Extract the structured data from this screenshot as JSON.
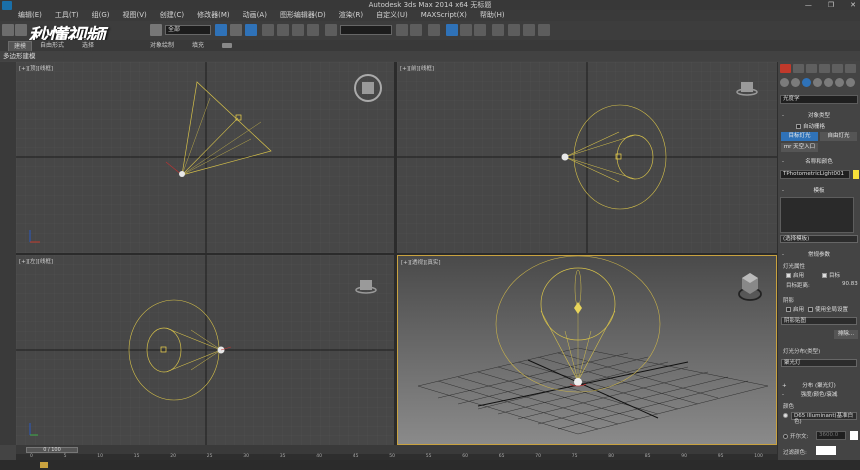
{
  "window": {
    "title": "Autodesk 3ds Max  2014 x64     无标题",
    "controls": [
      "—",
      "❐",
      "✕"
    ]
  },
  "menu": [
    "编辑(E)",
    "工具(T)",
    "组(G)",
    "视图(V)",
    "创建(C)",
    "修改器(M)",
    "动画(A)",
    "图形编辑器(D)",
    "渲染(R)",
    "自定义(U)",
    "MAXScript(X)",
    "帮助(H)"
  ],
  "toolbar": {
    "selection_filter": "全部",
    "view_dropdown": "视图",
    "named_set": ""
  },
  "watermark": "秒懂视频",
  "ribbon": {
    "tabs": [
      "建模",
      "自由形式",
      "选择",
      "对象绘制",
      "填充"
    ],
    "active_tab": "建模"
  },
  "subbar_label": "多边形建模",
  "viewports": [
    {
      "label": "[+][顶][线框]",
      "name": "top"
    },
    {
      "label": "[+][前][线框]",
      "name": "front"
    },
    {
      "label": "[+][左][线框]",
      "name": "left"
    },
    {
      "label": "[+][透视][真实]",
      "name": "perspective"
    }
  ],
  "command_panel": {
    "category_dropdown": "光度学",
    "object_type_title": "对象类型",
    "auto_grid": "自动栅格",
    "btn_target_light": "目标灯光",
    "btn_free_light": "自由灯光",
    "btn_sky_portal": "mr 天空入口",
    "name_color_title": "名称和颜色",
    "object_name": "TPhotometricLight001",
    "template_title": "模板",
    "template_select": "(选择模板)",
    "general_params_title": "常规参数",
    "light_props_title": "灯光属性",
    "enabled_label": "启用",
    "targeted_label": "目标",
    "target_distance_label": "目标距离:",
    "target_distance_value": "90.83",
    "shadows_title": "阴影",
    "shadows_enabled": "启用",
    "use_global": "使用全局设置",
    "shadow_type": "阴影贴图",
    "exclude_btn": "排除...",
    "distribution_title": "灯光分布(类型)",
    "distribution_value": "聚光灯",
    "dist_rollout_title": "分布 (聚光灯)",
    "intensity_title": "强度/颜色/衰减",
    "color_label": "颜色",
    "color_preset": "D65 Illuminant(基准白色)",
    "kelvin_label": "开尔文:",
    "kelvin_value": "3600.0",
    "filter_color_label": "过滤颜色:"
  },
  "timeline": {
    "slider_label": "0 / 100",
    "ticks": [
      "0",
      "5",
      "10",
      "15",
      "20",
      "25",
      "30",
      "35",
      "40",
      "45",
      "50",
      "55",
      "60",
      "65",
      "70",
      "75",
      "80",
      "85",
      "90",
      "95",
      "100"
    ]
  },
  "colors": {
    "light_wire": "#d6c14a",
    "active_border": "#c9a23f",
    "button_blue": "#2f72b8",
    "swatch_yellow": "#f7e03a"
  }
}
